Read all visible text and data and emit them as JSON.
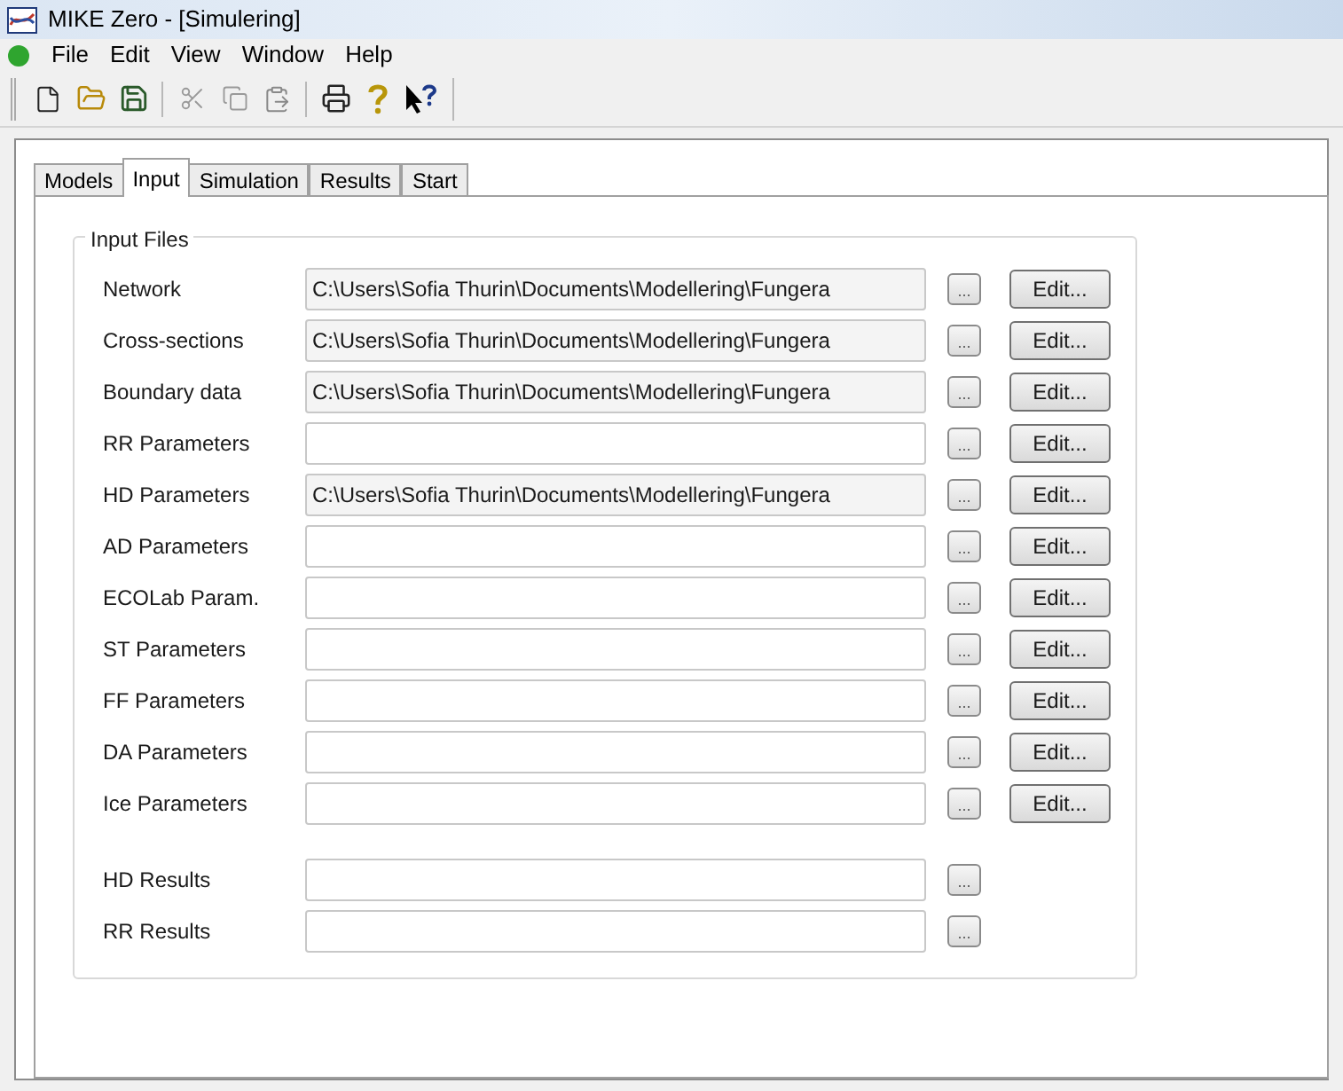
{
  "window": {
    "title": "MIKE Zero - [Simulering]"
  },
  "menu": [
    "File",
    "Edit",
    "View",
    "Window",
    "Help"
  ],
  "tabs": [
    {
      "label": "Models",
      "selected": false
    },
    {
      "label": "Input",
      "selected": true
    },
    {
      "label": "Simulation",
      "selected": false
    },
    {
      "label": "Results",
      "selected": false
    },
    {
      "label": "Start",
      "selected": false
    }
  ],
  "group": {
    "title": "Input Files",
    "rows": [
      {
        "kind": "edit",
        "label": "Network",
        "value": "C:\\Users\\Sofia Thurin\\Documents\\Modellering\\Fungera",
        "browse": "...",
        "edit": "Edit..."
      },
      {
        "kind": "edit",
        "label": "Cross-sections",
        "value": "C:\\Users\\Sofia Thurin\\Documents\\Modellering\\Fungera",
        "browse": "...",
        "edit": "Edit..."
      },
      {
        "kind": "edit",
        "label": "Boundary data",
        "value": "C:\\Users\\Sofia Thurin\\Documents\\Modellering\\Fungera",
        "browse": "...",
        "edit": "Edit..."
      },
      {
        "kind": "edit",
        "label": "RR Parameters",
        "browse": "...",
        "edit": "Edit..."
      },
      {
        "kind": "edit",
        "label": "HD Parameters",
        "value": "C:\\Users\\Sofia Thurin\\Documents\\Modellering\\Fungera",
        "browse": "...",
        "edit": "Edit..."
      },
      {
        "kind": "edit",
        "label": "AD Parameters",
        "browse": "...",
        "edit": "Edit..."
      },
      {
        "kind": "edit",
        "label": "ECOLab Param.",
        "browse": "...",
        "edit": "Edit..."
      },
      {
        "kind": "edit",
        "label": "ST Parameters",
        "browse": "...",
        "edit": "Edit..."
      },
      {
        "kind": "edit",
        "label": "FF Parameters",
        "browse": "...",
        "edit": "Edit..."
      },
      {
        "kind": "edit",
        "label": "DA Parameters",
        "browse": "...",
        "edit": "Edit..."
      },
      {
        "kind": "edit",
        "label": "Ice Parameters",
        "browse": "...",
        "edit": "Edit..."
      },
      {
        "kind": "result",
        "label": "HD Results",
        "browse": "..."
      },
      {
        "kind": "result",
        "label": "RR Results",
        "browse": "..."
      }
    ]
  }
}
